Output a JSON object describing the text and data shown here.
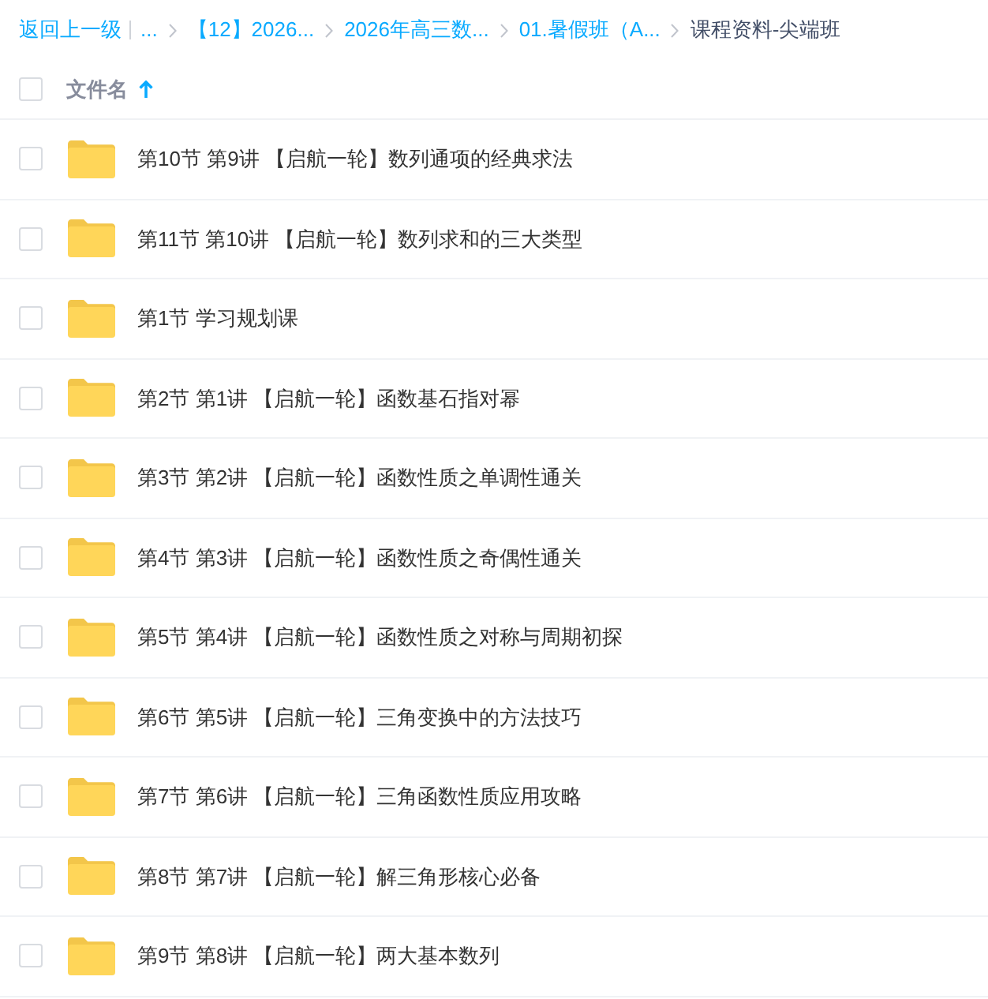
{
  "breadcrumb": {
    "back_link": "返回上一级",
    "items": [
      {
        "text": "...",
        "current": false
      },
      {
        "text": "【12】2026...",
        "current": false
      },
      {
        "text": "2026年高三数...",
        "current": false
      },
      {
        "text": "01.暑假班（A...",
        "current": false
      },
      {
        "text": "课程资料-尖端班",
        "current": true
      }
    ]
  },
  "header": {
    "select_all": {
      "checked": false
    },
    "column": "文件名",
    "sort_ascending": true
  },
  "rows": [
    {
      "name": "第10节 第9讲 【启航一轮】数列通项的经典求法",
      "checked": false
    },
    {
      "name": "第11节 第10讲 【启航一轮】数列求和的三大类型",
      "checked": false
    },
    {
      "name": "第1节 学习规划课",
      "checked": false
    },
    {
      "name": "第2节 第1讲 【启航一轮】函数基石指对幂",
      "checked": false
    },
    {
      "name": "第3节 第2讲 【启航一轮】函数性质之单调性通关",
      "checked": false
    },
    {
      "name": "第4节 第3讲 【启航一轮】函数性质之奇偶性通关",
      "checked": false
    },
    {
      "name": "第5节 第4讲 【启航一轮】函数性质之对称与周期初探",
      "checked": false
    },
    {
      "name": "第6节 第5讲 【启航一轮】三角变换中的方法技巧",
      "checked": false
    },
    {
      "name": "第7节 第6讲 【启航一轮】三角函数性质应用攻略",
      "checked": false
    },
    {
      "name": "第8节 第7讲 【启航一轮】解三角形核心必备",
      "checked": false
    },
    {
      "name": "第9节 第8讲 【启航一轮】两大基本数列",
      "checked": false
    }
  ]
}
